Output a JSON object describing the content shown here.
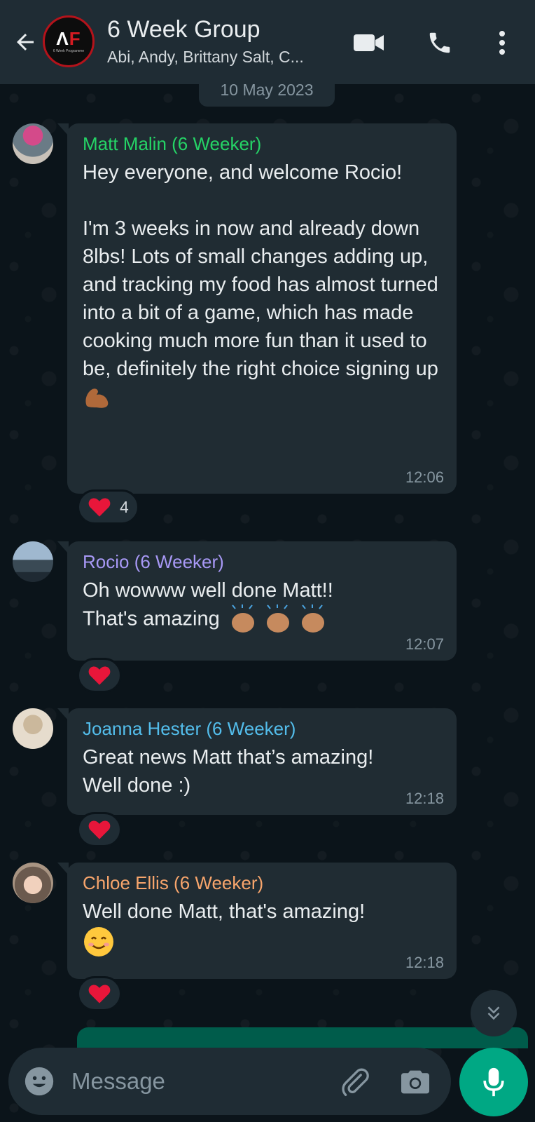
{
  "header": {
    "title": "6 Week Group",
    "members": "Abi, Andy, Brittany Salt, C...",
    "logo_text_a": "Λ",
    "logo_text_f": "F",
    "logo_sub": "6 Week Programme",
    "icons": {
      "back": "arrow-left-icon",
      "video": "video-camera-icon",
      "call": "phone-icon",
      "menu": "more-vertical-icon"
    }
  },
  "date_chip": "10 May 2023",
  "messages": [
    {
      "sender": "Matt Malin (6 Weeker)",
      "sender_color": "#25d366",
      "text": "Hey everyone, and welcome Rocio!\n\nI'm 3 weeks in now and already down 8lbs! Lots of small changes adding up, and tracking my food has almost turned into a bit of a game, which has made cooking much more fun than it used to be, definitely the right choice signing up",
      "emoji": "flexed-biceps-emoji",
      "time": "12:06",
      "reaction": {
        "emoji": "red-heart-emoji",
        "count": "4"
      }
    },
    {
      "sender": "Rocio (6 Weeker)",
      "sender_color": "#a798f5",
      "text": "Oh wowww well done Matt!!\nThat's amazing",
      "emoji": "clapping-hands-emoji",
      "time": "12:07",
      "reaction": {
        "emoji": "red-heart-emoji",
        "count": ""
      }
    },
    {
      "sender": "Joanna Hester (6 Weeker)",
      "sender_color": "#53bdeb",
      "text": "Great news Matt that’s amazing!\nWell done :)",
      "time": "12:18",
      "reaction": {
        "emoji": "red-heart-emoji",
        "count": ""
      }
    },
    {
      "sender": "Chloe Ellis (6 Weeker)",
      "sender_color": "#f7a56c",
      "text": "Well done Matt, that's amazing!",
      "emoji": "smiling-face-emoji",
      "time": "12:18",
      "reaction": {
        "emoji": "red-heart-emoji",
        "count": ""
      }
    }
  ],
  "input": {
    "placeholder": "Message",
    "value": "",
    "icons": {
      "emoji": "emoji-icon",
      "attach": "paperclip-icon",
      "camera": "camera-icon",
      "mic": "microphone-icon",
      "scroll": "double-chevron-down-icon"
    }
  },
  "colors": {
    "background": "#0b141a",
    "header": "#1f2c34",
    "bubble": "#202c33",
    "accent": "#00a884",
    "heart": "#e8163a"
  }
}
